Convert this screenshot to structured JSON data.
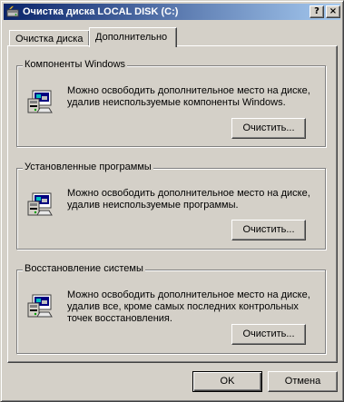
{
  "window": {
    "title": "Очистка диска LOCAL DISK (C:)",
    "help_label": "?",
    "close_label": "×"
  },
  "tabs": [
    {
      "label": "Очистка диска",
      "active": false
    },
    {
      "label": "Дополнительно",
      "active": true
    }
  ],
  "groups": [
    {
      "title": "Компоненты Windows",
      "description": "Можно освободить дополнительное место на диске, удалив неиспользуемые компоненты Windows.",
      "button_label": "Очистить..."
    },
    {
      "title": "Установленные программы",
      "description": "Можно освободить дополнительное место на диске, удалив неиспользуемые программы.",
      "button_label": "Очистить..."
    },
    {
      "title": "Восстановление системы",
      "description": "Можно освободить дополнительное место на диске, удалив все, кроме самых последних контрольных точек восстановления.",
      "button_label": "Очистить..."
    }
  ],
  "footer": {
    "ok_label": "OK",
    "cancel_label": "Отмена"
  },
  "icons": {
    "title_icon": "disk-cleanup-icon",
    "group_icon": "setup-program-icon"
  },
  "colors": {
    "face": "#d4d0c8",
    "title_start": "#0a246a",
    "title_end": "#a6caf0"
  }
}
